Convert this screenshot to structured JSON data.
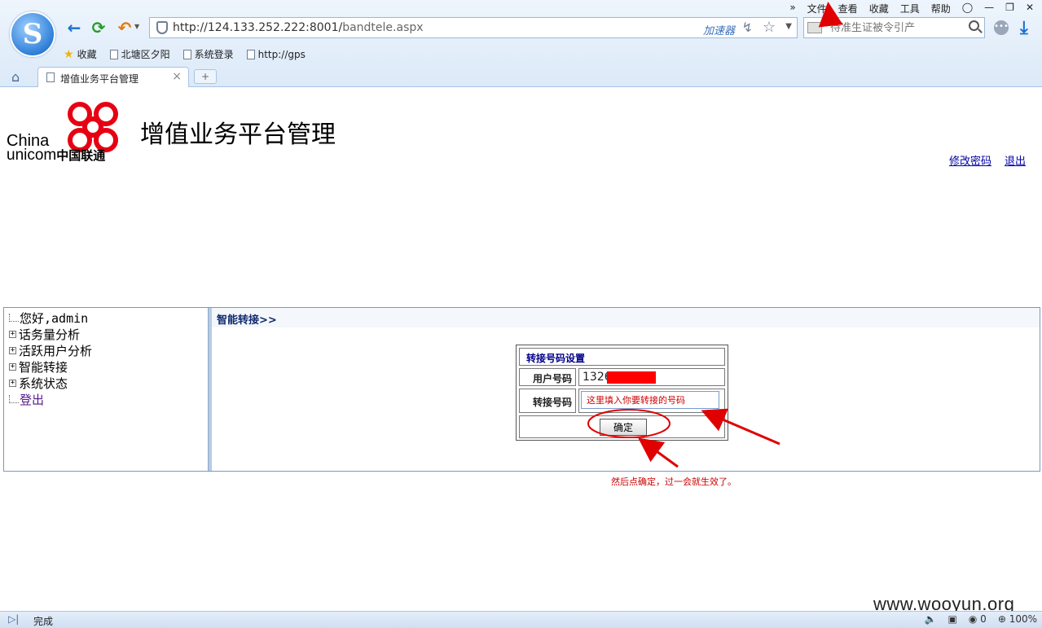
{
  "browser": {
    "menu": [
      "»",
      "文件",
      "查看",
      "收藏",
      "工具",
      "帮助"
    ],
    "url_host": "http://124.133.252.222:8001/",
    "url_path": "bandtele.aspx",
    "accelerator_label": "加速器",
    "search_placeholder": "待准生证被令引产",
    "bookmarks": [
      "收藏",
      "北塘区夕阳",
      "系统登录",
      "http://gps"
    ],
    "tab_title": "增值业务平台管理",
    "tab_close": "×",
    "new_tab": "+",
    "status_text": "完成",
    "status_counter": "0",
    "zoom": "100%"
  },
  "page": {
    "logo_line1": "China",
    "logo_line2": "unicom",
    "logo_cn": "中国联通",
    "title": "增值业务平台管理",
    "change_password": "修改密码",
    "logout": "退出"
  },
  "tree": {
    "items": [
      {
        "label": "您好,admin",
        "expandable": false
      },
      {
        "label": "话务量分析",
        "expandable": true
      },
      {
        "label": "活跃用户分析",
        "expandable": true
      },
      {
        "label": "智能转接",
        "expandable": true
      },
      {
        "label": "系统状态",
        "expandable": true
      },
      {
        "label": "登出",
        "expandable": false
      }
    ]
  },
  "main": {
    "breadcrumb": "智能转接>>",
    "form": {
      "title": "转接号码设置",
      "user_label": "用户号码",
      "user_value": "1326",
      "forward_label": "转接号码",
      "forward_value": "这里填入你要转接的号码",
      "ok_button": "确定"
    }
  },
  "annotation_text": "然后点确定，过一会就生效了。",
  "watermark": "www.wooyun.org",
  "colors": {
    "unicom_red": "#e60012",
    "annotation_red": "#e00000",
    "link_blue": "#0000aa"
  }
}
